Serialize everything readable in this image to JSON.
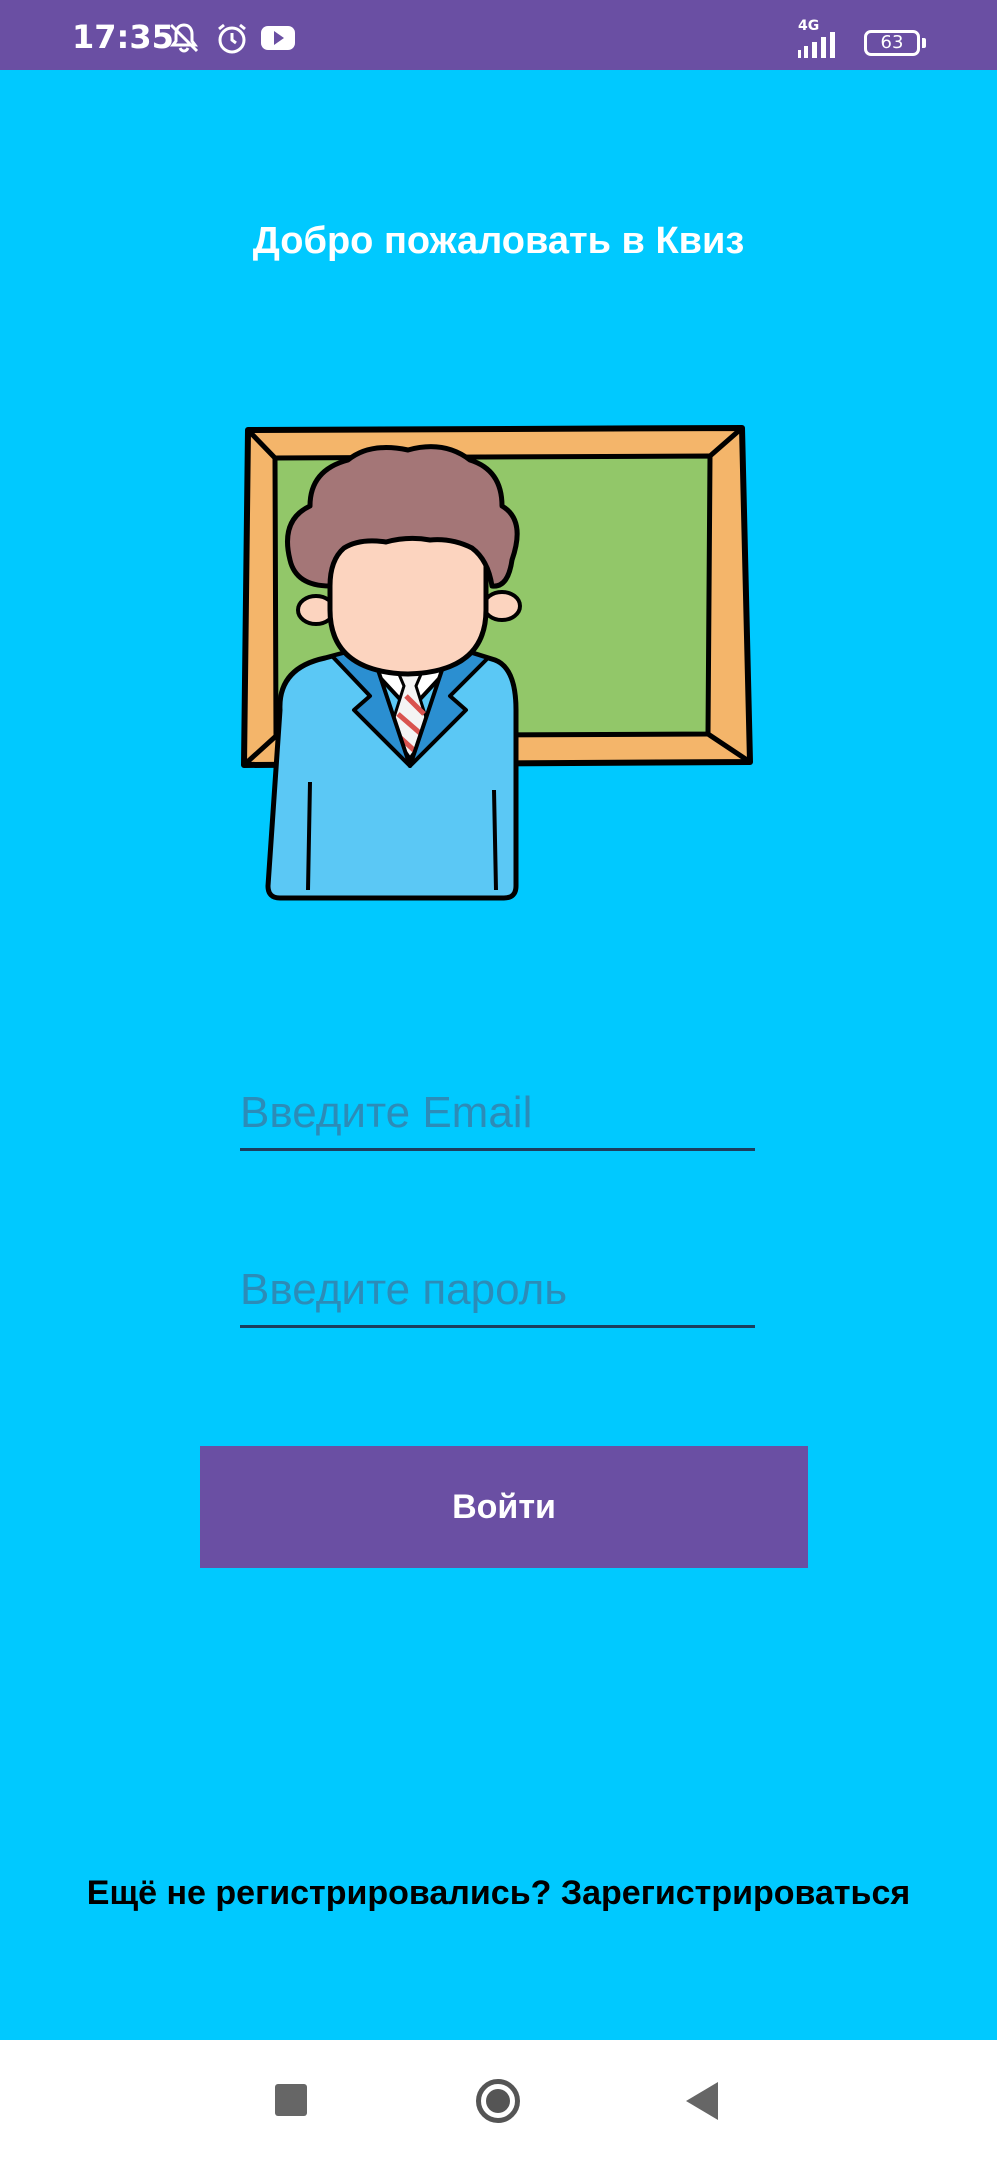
{
  "status_bar": {
    "time": "17:35",
    "network_label": "4G",
    "battery_level": "63",
    "icons": [
      "notifications-off-icon",
      "alarm-icon",
      "youtube-icon",
      "signal-icon",
      "battery-icon"
    ]
  },
  "screen": {
    "title": "Добро пожаловать в Квиз",
    "illustration": "teacher-at-chalkboard-illustration",
    "email_placeholder": "Введите Email",
    "email_value": "",
    "password_placeholder": "Введите пароль",
    "password_value": "",
    "login_label": "Войти",
    "register_prompt": "Ещё не регистрировались?",
    "register_link": "Зарегистрироваться"
  },
  "colors": {
    "background": "#00C9FF",
    "accent": "#6A4FA3",
    "status_bar": "#6A4FA3",
    "nav_bar": "#FFFFFF"
  },
  "nav_bar": {
    "icons": [
      "recent-apps-icon",
      "home-icon",
      "back-icon"
    ]
  }
}
